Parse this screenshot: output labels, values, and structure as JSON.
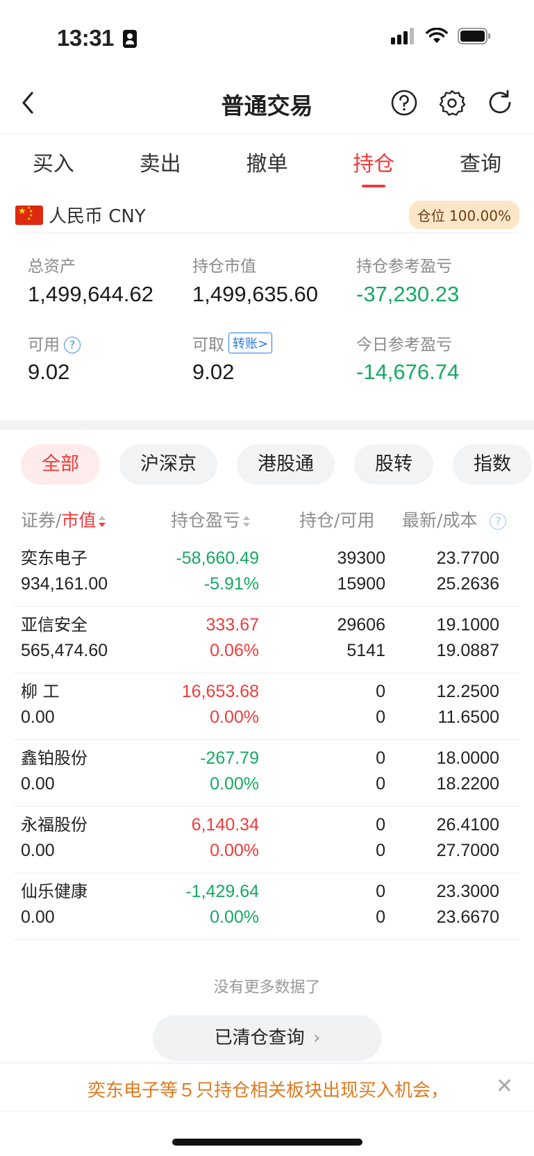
{
  "status_bar": {
    "time": "13:31"
  },
  "header": {
    "title": "普通交易"
  },
  "tabs": [
    {
      "label": "买入",
      "active": false
    },
    {
      "label": "卖出",
      "active": false
    },
    {
      "label": "撤单",
      "active": false
    },
    {
      "label": "持仓",
      "active": true
    },
    {
      "label": "查询",
      "active": false
    }
  ],
  "currency": {
    "label": "人民币 CNY",
    "position_badge": "仓位 100.00%"
  },
  "summary": {
    "total_assets_label": "总资产",
    "total_assets": "1,499,644.62",
    "market_value_label": "持仓市值",
    "market_value": "1,499,635.60",
    "holding_pl_label": "持仓参考盈亏",
    "holding_pl": "-37,230.23",
    "available_label": "可用",
    "available": "9.02",
    "withdrawable_label": "可取",
    "withdrawable": "9.02",
    "transfer_label": "转账>",
    "today_pl_label": "今日参考盈亏",
    "today_pl": "-14,676.74"
  },
  "filters": [
    "全部",
    "沪深京",
    "港股通",
    "股转",
    "指数"
  ],
  "table_header": {
    "security": "证券",
    "market_value": "市值",
    "holding_pl": "持仓盈亏",
    "position": "持仓",
    "available": "可用",
    "latest": "最新",
    "cost": "成本"
  },
  "rows": [
    {
      "name": "奕东电子",
      "mv": "934,161.00",
      "pl": "-58,660.49",
      "pl_pct": "-5.91%",
      "pos": "39300",
      "avail": "15900",
      "latest": "23.7700",
      "cost": "25.2636",
      "pl_color": "green",
      "pct_color": "green"
    },
    {
      "name": "亚信安全",
      "mv": "565,474.60",
      "pl": "333.67",
      "pl_pct": "0.06%",
      "pos": "29606",
      "avail": "5141",
      "latest": "19.1000",
      "cost": "19.0887",
      "pl_color": "red",
      "pct_color": "red"
    },
    {
      "name": "柳 工",
      "mv": "0.00",
      "pl": "16,653.68",
      "pl_pct": "0.00%",
      "pos": "0",
      "avail": "0",
      "latest": "12.2500",
      "cost": "11.6500",
      "pl_color": "red",
      "pct_color": "red"
    },
    {
      "name": "鑫铂股份",
      "mv": "0.00",
      "pl": "-267.79",
      "pl_pct": "0.00%",
      "pos": "0",
      "avail": "0",
      "latest": "18.0000",
      "cost": "18.2200",
      "pl_color": "green",
      "pct_color": "green"
    },
    {
      "name": "永福股份",
      "mv": "0.00",
      "pl": "6,140.34",
      "pl_pct": "0.00%",
      "pos": "0",
      "avail": "0",
      "latest": "26.4100",
      "cost": "27.7000",
      "pl_color": "red",
      "pct_color": "red"
    },
    {
      "name": "仙乐健康",
      "mv": "0.00",
      "pl": "-1,429.64",
      "pl_pct": "0.00%",
      "pos": "0",
      "avail": "0",
      "latest": "23.3000",
      "cost": "23.6670",
      "pl_color": "green",
      "pct_color": "green"
    }
  ],
  "no_more": "没有更多数据了",
  "cleared_query": "已清仓查询",
  "banner": {
    "text": "奕东电子等５只持仓相关板块出现买入机会，"
  },
  "colors": {
    "red": "#f03a3a",
    "green": "#16a862",
    "orange": "#e07a1f",
    "blue": "#2a7ae4"
  }
}
